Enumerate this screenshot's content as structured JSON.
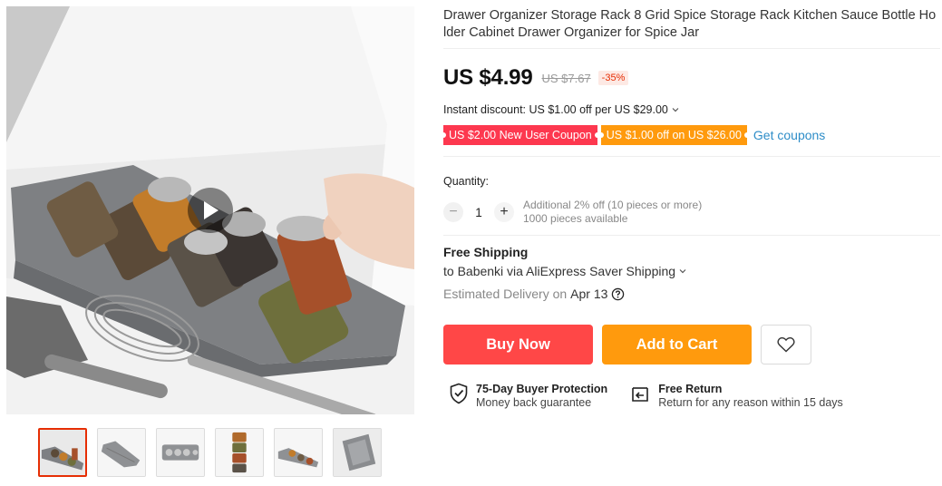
{
  "product": {
    "title": "Drawer Organizer Storage Rack 8 Grid Spice Storage Rack Kitchen Sauce Bottle Holder Cabinet Drawer Organizer for Spice Jar"
  },
  "price": {
    "current": "US $4.99",
    "original": "US $7.67",
    "discount": "-35%"
  },
  "instant_discount": "Instant discount: US $1.00 off per US $29.00",
  "coupons": [
    {
      "label": "US $2.00 New User Coupon",
      "color": "#fd384f"
    },
    {
      "label": "US $1.00 off on US $26.00",
      "color": "#ff9a0d"
    }
  ],
  "get_coupons_label": "Get coupons",
  "quantity": {
    "label": "Quantity:",
    "value": "1",
    "minus": "−",
    "plus": "+",
    "additional": "Additional 2% off (10 pieces or more)",
    "available": "1000 pieces available"
  },
  "shipping": {
    "title": "Free Shipping",
    "to": "to Babenki via AliExpress Saver Shipping",
    "estimated_label": "Estimated Delivery on",
    "estimated_date": "Apr 13"
  },
  "buttons": {
    "buy_now": "Buy Now",
    "add_to_cart": "Add to Cart"
  },
  "guarantees": [
    {
      "title": "75-Day Buyer Protection",
      "subtitle": "Money back guarantee",
      "icon": "shield-check-icon"
    },
    {
      "title": "Free Return",
      "subtitle": "Return for any reason within 15 days",
      "icon": "return-box-icon"
    }
  ],
  "colors": {
    "buy": "#ff4747",
    "cart": "#ff9a0d",
    "link": "#2e8dc8",
    "accent": "#e62e04"
  }
}
